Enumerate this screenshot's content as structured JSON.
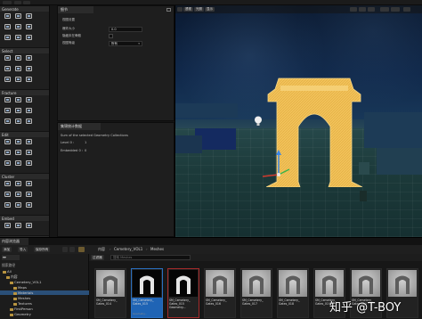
{
  "left_panel": {
    "sections": [
      {
        "label": "Generate",
        "tools": [
          "",
          "",
          "",
          "",
          "",
          "",
          "",
          "",
          ""
        ]
      },
      {
        "label": "Select",
        "tools": [
          "",
          "",
          "",
          "",
          "",
          "",
          "",
          "",
          ""
        ]
      },
      {
        "label": "Fracture",
        "tools": [
          "",
          "",
          "",
          "",
          "",
          "",
          "",
          "",
          ""
        ]
      },
      {
        "label": "Edit",
        "tools": [
          "",
          "",
          "",
          "",
          "",
          "",
          "",
          "",
          ""
        ]
      },
      {
        "label": "Cluster",
        "tools": [
          "",
          "",
          "",
          "",
          "",
          "",
          "",
          "",
          ""
        ]
      },
      {
        "label": "Embed",
        "tools": [
          "",
          "",
          ""
        ]
      },
      {
        "label": "Utilities",
        "tools": []
      }
    ]
  },
  "details": {
    "tab": "细节",
    "group": "视图设置",
    "rows": [
      {
        "key": "爆炸大小",
        "value": "0.0"
      },
      {
        "key": "隐藏未在骨骼",
        "value": ""
      },
      {
        "key": "视图等级",
        "value": "所有"
      }
    ]
  },
  "stats": {
    "tab": "集锦统计数据",
    "line1": "Sum of the selected Geometry Collections",
    "line2": "Level 0 :",
    "line2_val": "1",
    "line3": "Embedded 0 :",
    "line3_val": "0"
  },
  "viewport": {
    "buttons": [
      "",
      "透视",
      "光照",
      "显示"
    ]
  },
  "content_browser": {
    "tab": "内容浏览器",
    "toolbar": {
      "add": "添加",
      "import": "导入",
      "save_all": "保存所有"
    },
    "breadcrumb": [
      "内容",
      "Cemetery_VOL1",
      "Meshes"
    ],
    "filters_label": "过滤器",
    "search_placeholder": "搜索 Meshes",
    "tree_header": "搜索路径",
    "tree": [
      {
        "label": "All",
        "level": 0
      },
      {
        "label": "内容",
        "level": 1
      },
      {
        "label": "Cemetery_VOL1",
        "level": 2
      },
      {
        "label": "Maps",
        "level": 3
      },
      {
        "label": "Materials",
        "level": 3
      },
      {
        "label": "Meshes",
        "level": 3
      },
      {
        "label": "Textures",
        "level": 3
      },
      {
        "label": "FirstPerson",
        "level": 2
      },
      {
        "label": "Geometry",
        "level": 2
      }
    ],
    "assets": [
      {
        "name": "SM_Cemetery_\nGates_014",
        "type": "",
        "style": "light"
      },
      {
        "name": "SM_Cemetery_\nGates_015",
        "type": "Geometry...",
        "style": "selected"
      },
      {
        "name": "SM_Cemetery_\nGates_015\nGeometry...",
        "type": "",
        "style": "red"
      },
      {
        "name": "SM_Cemetery_\nGates_016",
        "type": "",
        "style": "light"
      },
      {
        "name": "SM_Cemetery_\nGates_017",
        "type": "",
        "style": "light"
      },
      {
        "name": "SM_Cemetery_\nGates_018",
        "type": "",
        "style": "light"
      },
      {
        "name": "SM_Cemetery_\nGates_019",
        "type": "",
        "style": "light"
      },
      {
        "name": "SM_Cemetery_\nGates_020",
        "type": "",
        "style": "light"
      },
      {
        "name": "",
        "type": "",
        "style": "light"
      }
    ]
  },
  "watermark": "知乎 @T-BOY",
  "colors": {
    "arch_fill": "#f2c25a",
    "selection_blue": "#1f64b5",
    "folder": "#b89440"
  }
}
